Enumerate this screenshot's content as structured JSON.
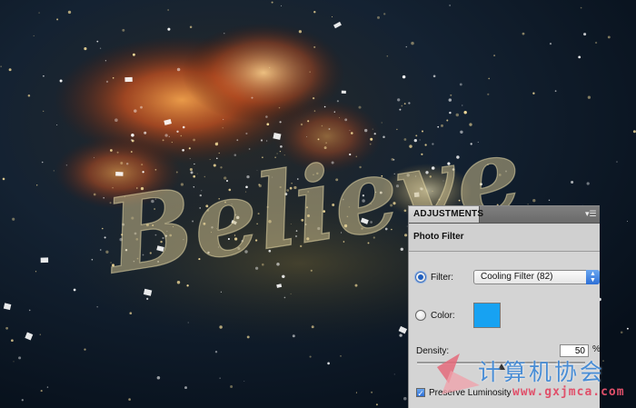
{
  "panel": {
    "tab_label": "ADJUSTMENTS",
    "menu_icon": "panel-menu-icon",
    "title": "Photo Filter",
    "filter_label": "Filter:",
    "filter_value": "Cooling Filter (82)",
    "filter_selected": true,
    "color_label": "Color:",
    "color_selected": false,
    "color_swatch": "#17a2f2",
    "density_label": "Density:",
    "density_value": "50",
    "density_unit": "%",
    "density_fraction": 0.5,
    "preserve_label": "Preserve Luminosity",
    "preserve_checked": true
  },
  "artwork": {
    "word": "Believe"
  },
  "watermark": {
    "text": "计算机协会",
    "url": "www.gxjmca.com"
  },
  "colors": {
    "accent_blue": "#2d6fd6",
    "nebula_orange": "#d9632a",
    "sparkle_gold": "#e8d18a"
  }
}
